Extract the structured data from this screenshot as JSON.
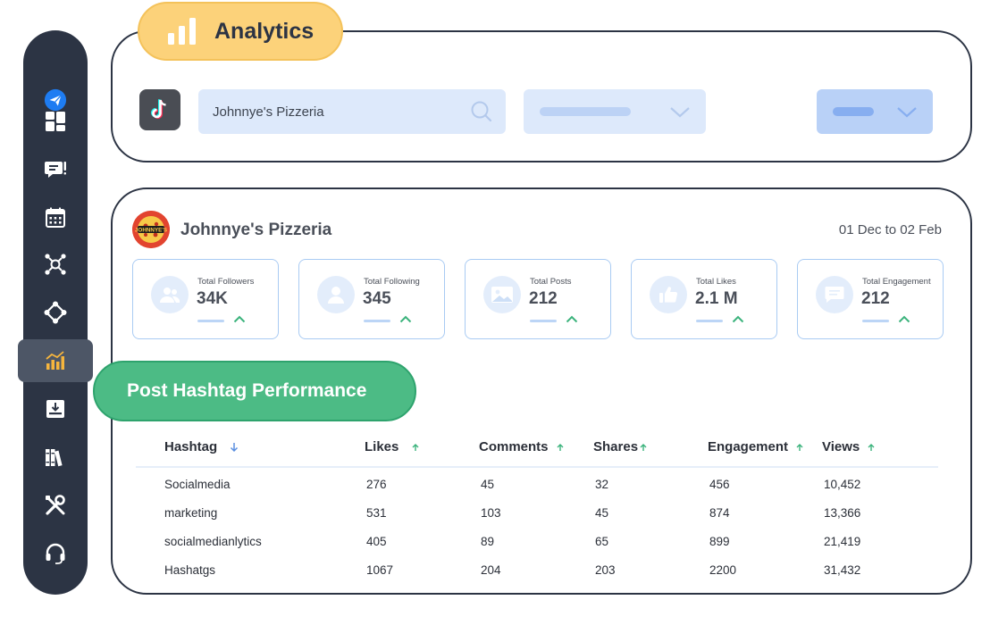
{
  "app": {
    "title": "Analytics"
  },
  "sidebar": {
    "items": [
      {
        "name": "send",
        "icon": "paper-plane-icon"
      },
      {
        "name": "dashboard",
        "icon": "grid-icon"
      },
      {
        "name": "messages",
        "icon": "chat-icon"
      },
      {
        "name": "calendar",
        "icon": "calendar-icon"
      },
      {
        "name": "network",
        "icon": "network-icon"
      },
      {
        "name": "connections",
        "icon": "nodes-icon"
      },
      {
        "name": "analytics",
        "icon": "bar-chart-icon",
        "active": true
      },
      {
        "name": "inbox",
        "icon": "inbox-download-icon"
      },
      {
        "name": "library",
        "icon": "books-icon"
      },
      {
        "name": "tools",
        "icon": "tools-icon"
      },
      {
        "name": "support",
        "icon": "headset-icon"
      }
    ]
  },
  "filters": {
    "platform_icon": "tiktok-icon",
    "search": {
      "value": "Johnnye's Pizzeria"
    }
  },
  "profile": {
    "name": "Johnnye's Pizzeria",
    "logo_text": "JOHNNYE'S",
    "date_range": "01 Dec to 02 Feb"
  },
  "stats": [
    {
      "label": "Total Followers",
      "value": "34K",
      "icon": "users-icon"
    },
    {
      "label": "Total Following",
      "value": "345",
      "icon": "user-icon"
    },
    {
      "label": "Total Posts",
      "value": "212",
      "icon": "image-icon"
    },
    {
      "label": "Total Likes",
      "value": "2.1 M",
      "icon": "thumbs-up-icon"
    },
    {
      "label": "Total Engagement",
      "value": "212",
      "icon": "comment-icon"
    }
  ],
  "hashtag_section": {
    "title": "Post Hashtag Performance",
    "columns": [
      "Hashtag",
      "Likes",
      "Comments",
      "Shares",
      "Engagement",
      "Views"
    ],
    "rows": [
      [
        "Socialmedia",
        "276",
        "45",
        "32",
        "456",
        "10,452"
      ],
      [
        "marketing",
        "531",
        "103",
        "45",
        "874",
        "13,366"
      ],
      [
        "socialmedianlytics",
        "405",
        "89",
        "65",
        "899",
        "21,419"
      ],
      [
        "Hashatgs",
        "1067",
        "204",
        "203",
        "2200",
        "31,432"
      ]
    ]
  },
  "colors": {
    "sidebar": "#2c3444",
    "analytics_pill": "#fcd27a",
    "hashtag_pill": "#4cbb85",
    "accent_blue": "#dde9fb",
    "trend_up": "#3bb37c"
  }
}
